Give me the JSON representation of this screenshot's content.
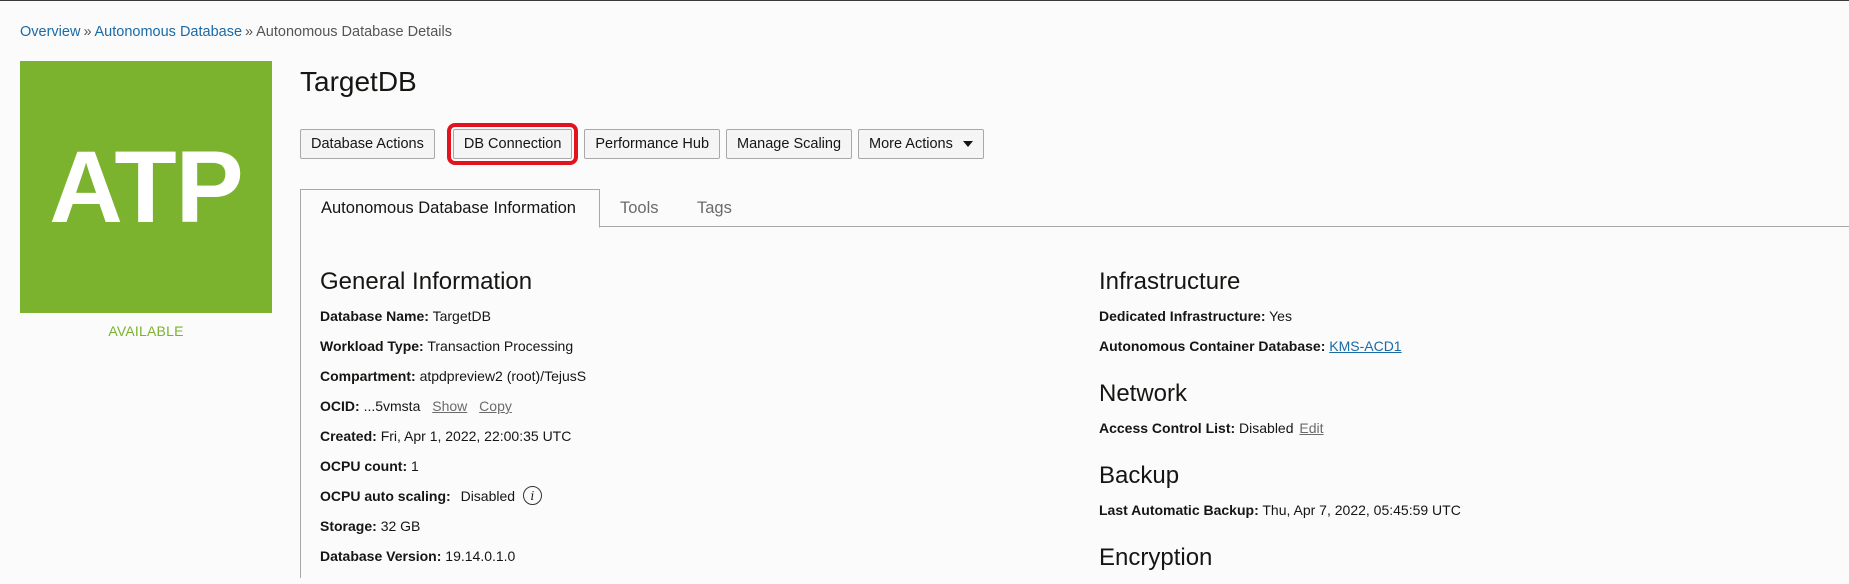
{
  "breadcrumb": {
    "items": [
      "Overview",
      "Autonomous Database",
      "Autonomous Database Details"
    ],
    "separator": "»"
  },
  "logo": {
    "text": "ATP",
    "color": "#7bb32e"
  },
  "status": "AVAILABLE",
  "page_title": "TargetDB",
  "actions": {
    "database_actions": "Database Actions",
    "db_connection": "DB Connection",
    "performance_hub": "Performance Hub",
    "manage_scaling": "Manage Scaling",
    "more_actions": "More Actions"
  },
  "highlight_color": "#e2131f",
  "tabs": [
    "Autonomous Database Information",
    "Tools",
    "Tags"
  ],
  "general": {
    "heading": "General Information",
    "database_name": {
      "label": "Database Name:",
      "value": "TargetDB"
    },
    "workload_type": {
      "label": "Workload Type:",
      "value": "Transaction Processing"
    },
    "compartment": {
      "label": "Compartment:",
      "value": "atpdpreview2 (root)/TejusS"
    },
    "ocid": {
      "label": "OCID:",
      "value": "...5vmsta",
      "show": "Show",
      "copy": "Copy"
    },
    "created": {
      "label": "Created:",
      "value": "Fri, Apr 1, 2022, 22:00:35 UTC"
    },
    "ocpu_count": {
      "label": "OCPU count:",
      "value": "1"
    },
    "ocpu_auto_scaling": {
      "label": "OCPU auto scaling:",
      "value": "Disabled",
      "icon": "info-icon"
    },
    "storage": {
      "label": "Storage:",
      "value": "32 GB"
    },
    "database_version": {
      "label": "Database Version:",
      "value": "19.14.0.1.0"
    }
  },
  "infrastructure": {
    "heading": "Infrastructure",
    "dedicated": {
      "label": "Dedicated Infrastructure:",
      "value": "Yes"
    },
    "container_db": {
      "label": "Autonomous Container Database:",
      "value": "KMS-ACD1"
    }
  },
  "network": {
    "heading": "Network",
    "acl": {
      "label": "Access Control List:",
      "value": "Disabled",
      "edit": "Edit"
    }
  },
  "backup": {
    "heading": "Backup",
    "last_backup": {
      "label": "Last Automatic Backup:",
      "value": "Thu, Apr 7, 2022, 05:45:59 UTC"
    }
  },
  "cut_off_heading": "Encryption"
}
